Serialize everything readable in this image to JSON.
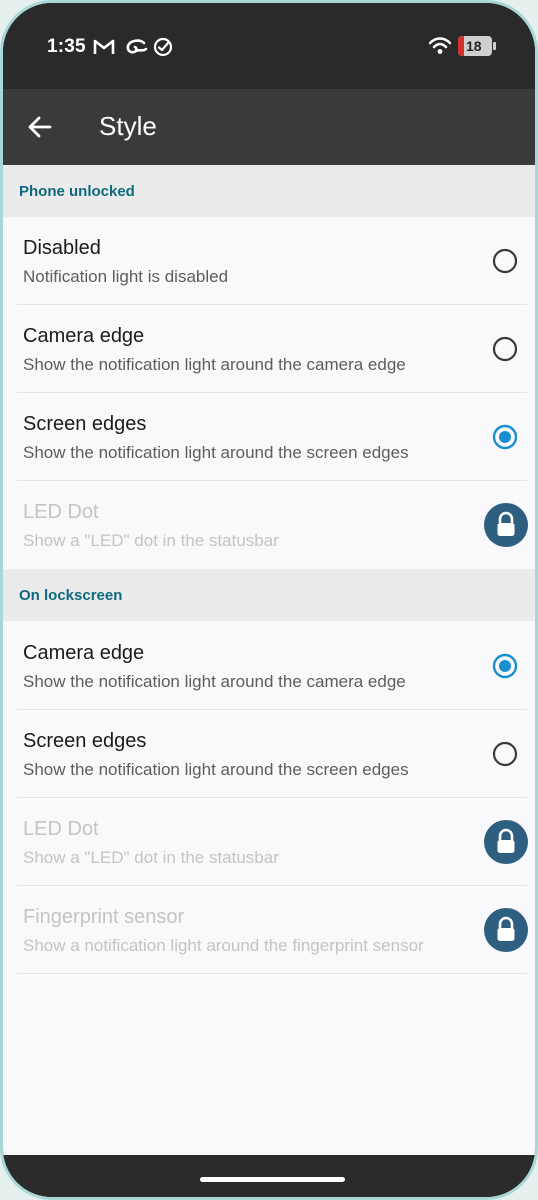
{
  "status_bar": {
    "time": "1:35",
    "notification_icons": [
      "gmail-icon",
      "app-swirl-icon",
      "check-circle-icon"
    ],
    "wifi_icon": "wifi-icon",
    "battery_level": "18",
    "battery_color": "#d32f2f"
  },
  "app_bar": {
    "back_icon": "back-arrow-icon",
    "title": "Style"
  },
  "sections": [
    {
      "header": "Phone unlocked",
      "items": [
        {
          "title": "Disabled",
          "subtitle": "Notification light is disabled",
          "control": "radio",
          "selected": false,
          "enabled": true
        },
        {
          "title": "Camera edge",
          "subtitle": "Show the notification light around the camera edge",
          "control": "radio",
          "selected": false,
          "enabled": true
        },
        {
          "title": "Screen edges",
          "subtitle": "Show the notification light around the screen edges",
          "control": "radio",
          "selected": true,
          "enabled": true
        },
        {
          "title": "LED Dot",
          "subtitle": "Show a \"LED\" dot in the statusbar",
          "control": "lock",
          "selected": false,
          "enabled": false
        }
      ]
    },
    {
      "header": "On lockscreen",
      "items": [
        {
          "title": "Camera edge",
          "subtitle": "Show the notification light around the camera edge",
          "control": "radio",
          "selected": true,
          "enabled": true
        },
        {
          "title": "Screen edges",
          "subtitle": "Show the notification light around the screen edges",
          "control": "radio",
          "selected": false,
          "enabled": true
        },
        {
          "title": "LED Dot",
          "subtitle": "Show a \"LED\" dot in the statusbar",
          "control": "lock",
          "selected": false,
          "enabled": false
        },
        {
          "title": "Fingerprint sensor",
          "subtitle": "Show a notification light around the fingerprint sensor",
          "control": "lock",
          "selected": false,
          "enabled": false
        }
      ]
    }
  ],
  "colors": {
    "accent": "#0e6a7e",
    "radio_selected": "#1a8fd0",
    "radio_unselected": "#3a3a3a",
    "lock_badge": "#2e5e80",
    "status_bar_bg": "#2a2a2a",
    "app_bar_bg": "#3a3a3a"
  }
}
